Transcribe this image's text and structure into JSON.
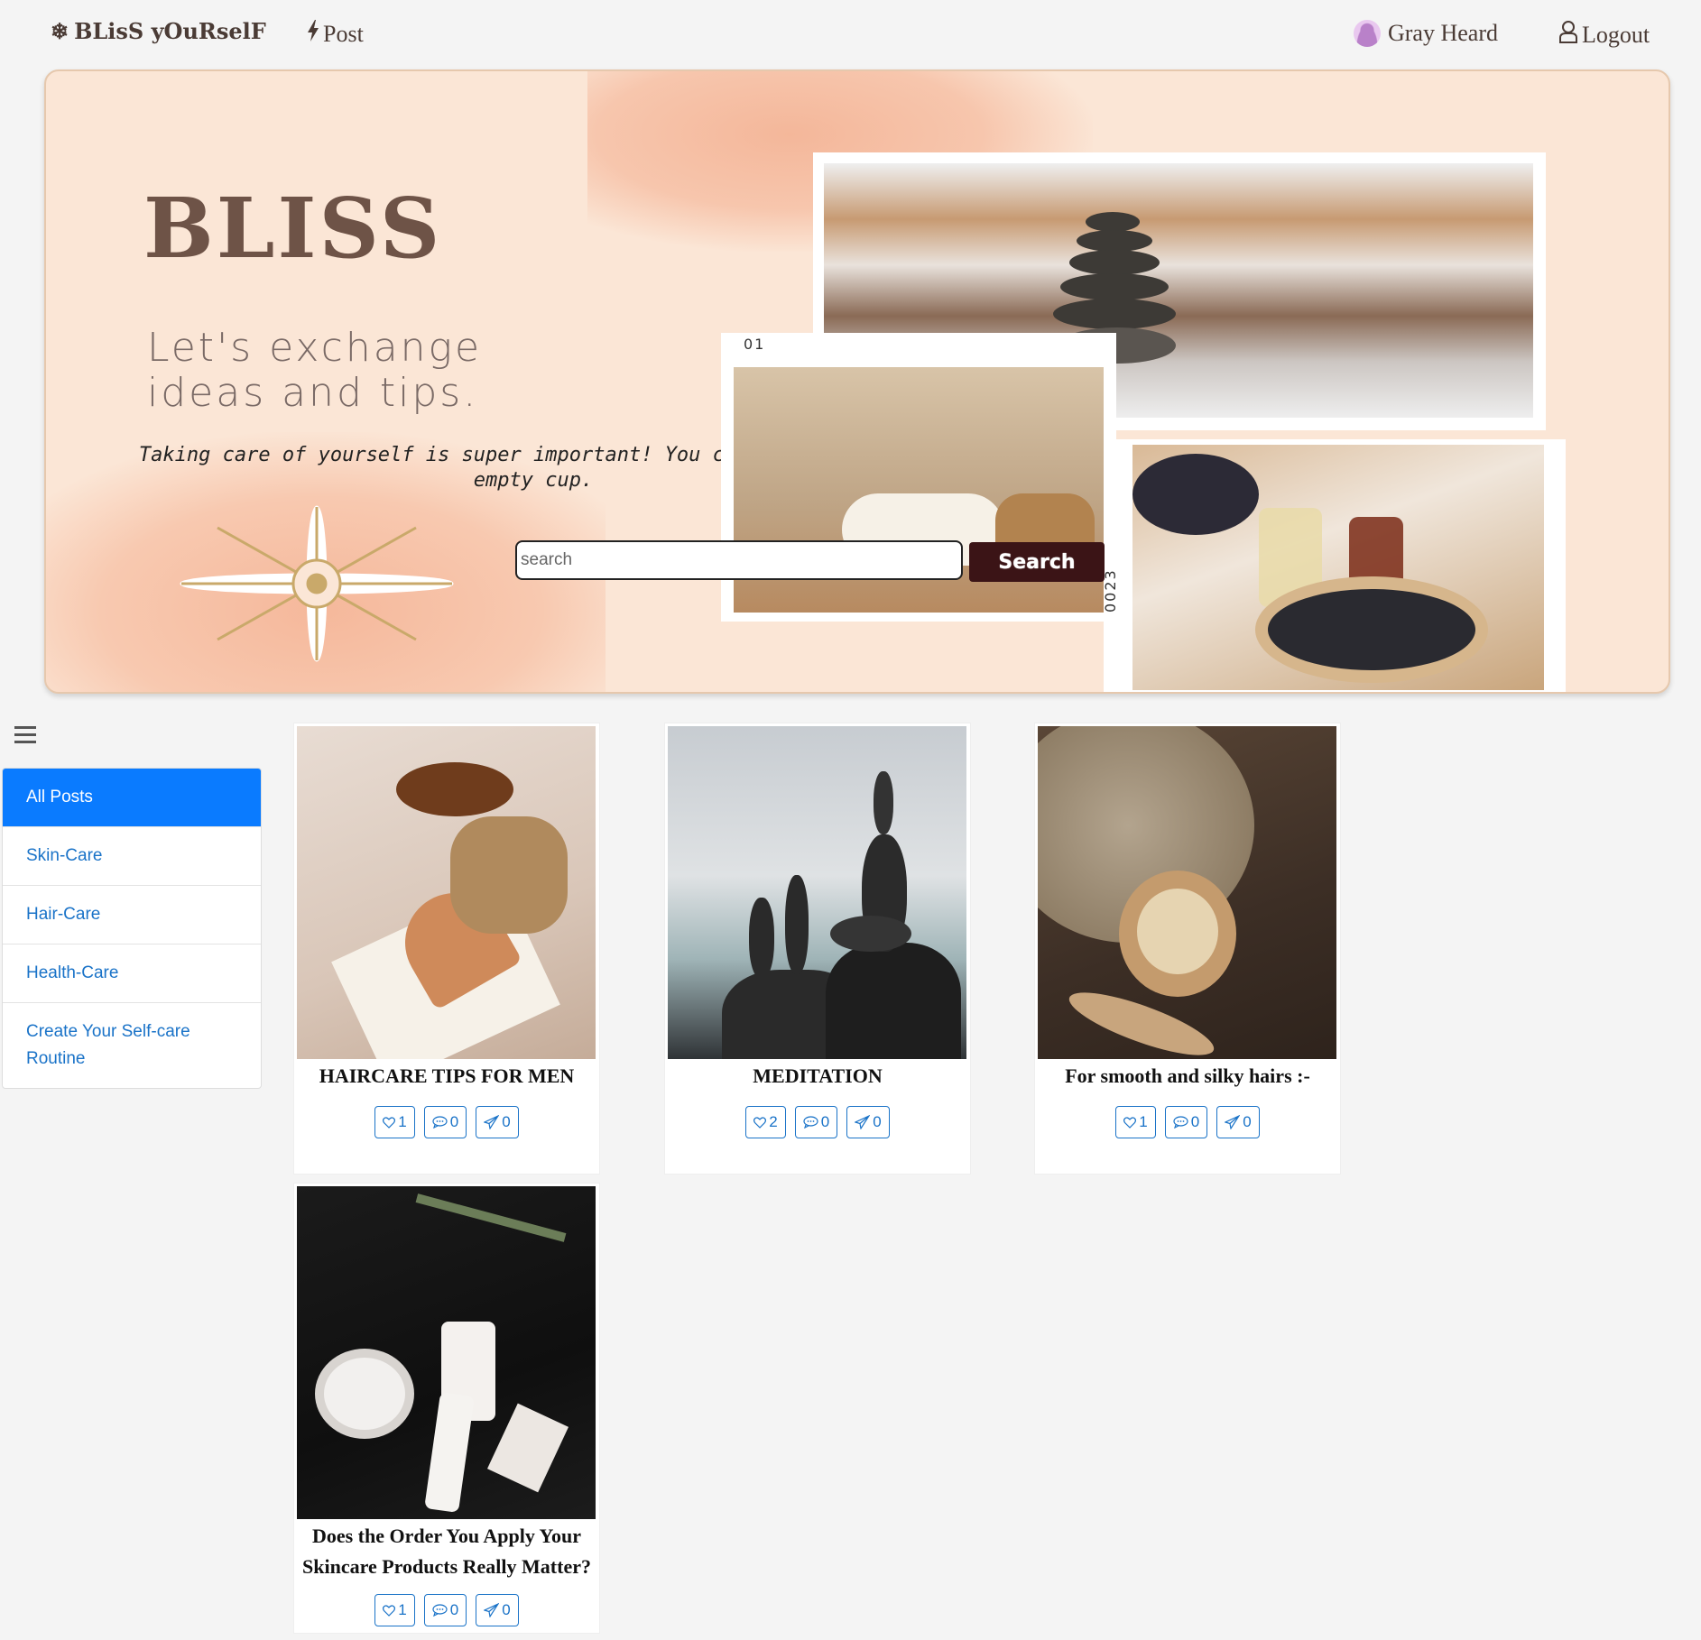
{
  "nav": {
    "brand": "BLisS yOuRselF",
    "post_label": "Post",
    "user_name": "Gray Heard",
    "logout_label": "Logout"
  },
  "hero": {
    "title": "BLISS",
    "subtitle": "Let's exchange ideas and tips.",
    "quote": "Taking care of yourself is super important! You can't pour from an empty cup.",
    "label_01": "01",
    "label_0023": "0023",
    "search_placeholder": "search",
    "search_button": "Search"
  },
  "sidebar": {
    "items": [
      {
        "label": "All Posts",
        "active": true
      },
      {
        "label": "Skin-Care"
      },
      {
        "label": "Hair-Care"
      },
      {
        "label": "Health-Care"
      },
      {
        "label": "Create Your Self-care Routine"
      }
    ]
  },
  "posts": [
    {
      "title": "HAIRCARE TIPS FOR MEN",
      "likes": "1",
      "comments": "0",
      "shares": "0"
    },
    {
      "title": "MEDITATION",
      "likes": "2",
      "comments": "0",
      "shares": "0"
    },
    {
      "title": "For smooth and silky hairs :-",
      "likes": "1",
      "comments": "0",
      "shares": "0"
    },
    {
      "title": "Does the Order You Apply Your Skincare Products Really Matter?",
      "likes": "1",
      "comments": "0",
      "shares": "0"
    }
  ],
  "colors": {
    "accent": "#0a7bff",
    "link": "#1a73c8",
    "search_button": "#3b1416",
    "hero_bg": "#fbe6d6"
  },
  "icons": {
    "brand": "snowflake-icon",
    "post": "lightning-icon",
    "user": "avatar",
    "logout": "user-outline-icon",
    "menu": "hamburger-icon",
    "like": "heart-icon",
    "comment": "chat-icon",
    "share": "send-icon"
  }
}
